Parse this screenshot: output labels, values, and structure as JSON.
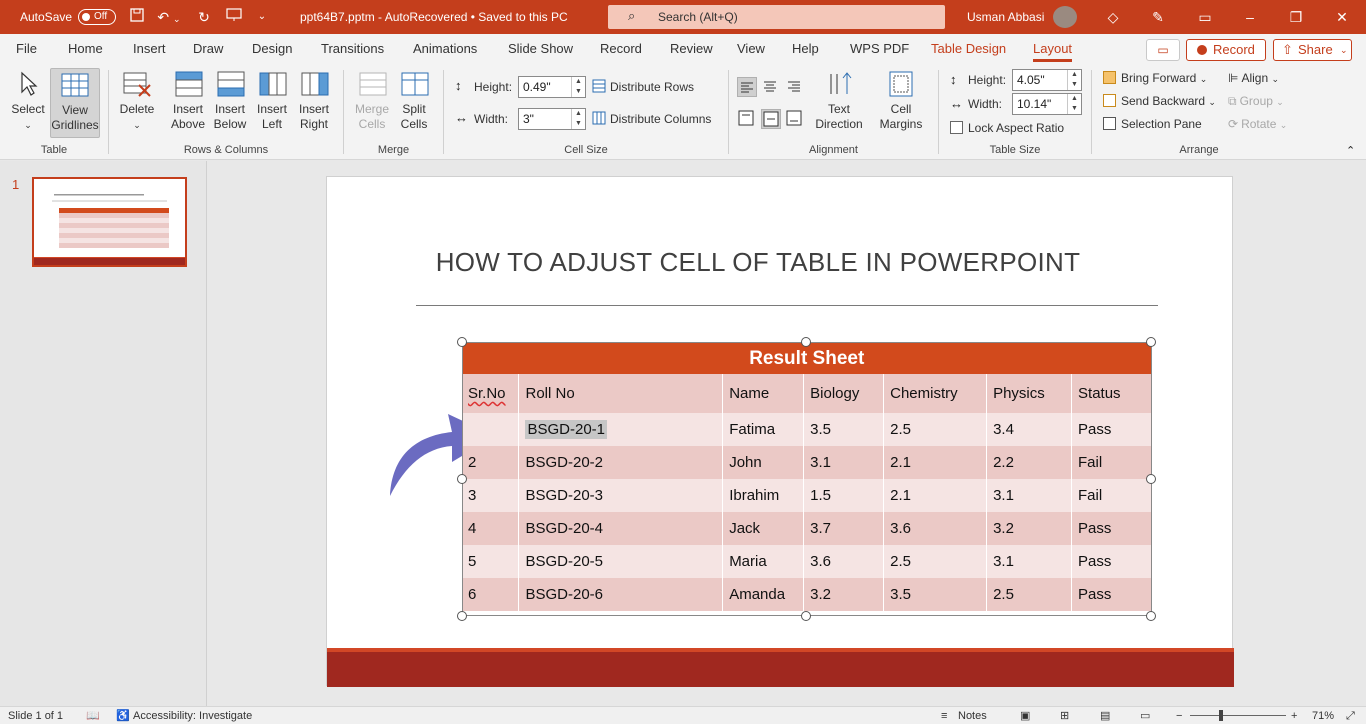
{
  "titlebar": {
    "autosave_label": "AutoSave",
    "autosave_state": "Off",
    "doc_title": "ppt64B7.pptm  -  AutoRecovered • Saved to this PC",
    "search_placeholder": "Search (Alt+Q)",
    "user_name": "Usman Abbasi"
  },
  "tabs": [
    "File",
    "Home",
    "Insert",
    "Draw",
    "Design",
    "Transitions",
    "Animations",
    "Slide Show",
    "Record",
    "Review",
    "View",
    "Help",
    "WPS PDF",
    "Table Design",
    "Layout"
  ],
  "active_tab": "Layout",
  "tab_actions": {
    "record": "Record",
    "share": "Share"
  },
  "ribbon": {
    "table_group": {
      "label": "Table",
      "select": "Select",
      "view_gridlines": "View Gridlines"
    },
    "rows_cols_group": {
      "label": "Rows & Columns",
      "delete": "Delete",
      "insert_above": "Insert Above",
      "insert_below": "Insert Below",
      "insert_left": "Insert Left",
      "insert_right": "Insert Right"
    },
    "merge_group": {
      "label": "Merge",
      "merge_cells": "Merge Cells",
      "split_cells": "Split Cells"
    },
    "cell_size_group": {
      "label": "Cell Size",
      "height_label": "Height:",
      "height_value": "0.49\"",
      "width_label": "Width:",
      "width_value": "3\"",
      "distribute_rows": "Distribute Rows",
      "distribute_columns": "Distribute Columns"
    },
    "alignment_group": {
      "label": "Alignment",
      "text_direction": "Text Direction",
      "cell_margins": "Cell Margins"
    },
    "table_size_group": {
      "label": "Table Size",
      "height_label": "Height:",
      "height_value": "4.05\"",
      "width_label": "Width:",
      "width_value": "10.14\"",
      "lock_aspect": "Lock Aspect Ratio"
    },
    "arrange_group": {
      "label": "Arrange",
      "bring_forward": "Bring Forward",
      "send_backward": "Send Backward",
      "selection_pane": "Selection Pane",
      "align": "Align",
      "group": "Group",
      "rotate": "Rotate"
    }
  },
  "thumbnail": {
    "slide_number": "1"
  },
  "slide": {
    "title": "HOW TO ADJUST CELL OF TABLE IN POWERPOINT",
    "table": {
      "heading": "Result  Sheet",
      "columns": [
        "Sr.No",
        "Roll No",
        "Name",
        "Biology",
        "Chemistry",
        "Physics",
        "Status"
      ],
      "rows": [
        [
          "",
          "BSGD-20-1",
          "Fatima",
          "3.5",
          "2.5",
          "3.4",
          "Pass"
        ],
        [
          "2",
          "BSGD-20-2",
          "John",
          "3.1",
          "2.1",
          "2.2",
          "Fail"
        ],
        [
          "3",
          "BSGD-20-3",
          "Ibrahim",
          "1.5",
          "2.1",
          "3.1",
          "Fail"
        ],
        [
          "4",
          "BSGD-20-4",
          "Jack",
          "3.7",
          "3.6",
          "3.2",
          "Pass"
        ],
        [
          "5",
          "BSGD-20-5",
          "Maria",
          "3.6",
          "2.5",
          "3.1",
          "Pass"
        ],
        [
          "6",
          "BSGD-20-6",
          "Amanda",
          "3.2",
          "3.5",
          "2.5",
          "Pass"
        ]
      ]
    }
  },
  "statusbar": {
    "slide_info": "Slide 1 of 1",
    "accessibility": "Accessibility: Investigate",
    "notes": "Notes",
    "zoom": "71%"
  },
  "colors": {
    "brand": "#c43e1c",
    "table_header": "#d24a1c",
    "footer": "#a0281f"
  }
}
